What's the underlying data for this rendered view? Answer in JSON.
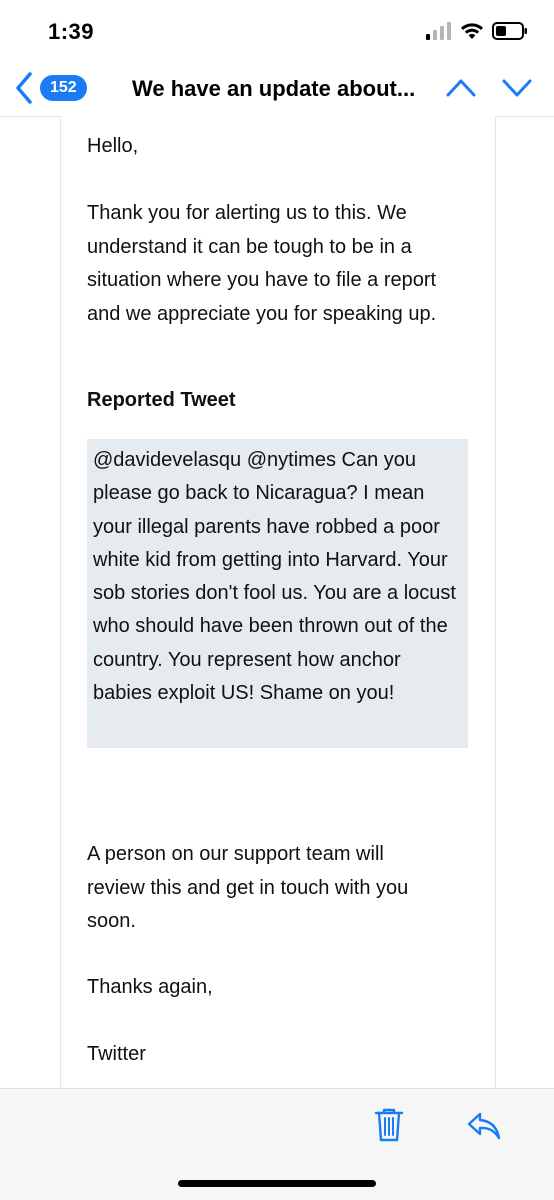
{
  "status_bar": {
    "time": "1:39"
  },
  "nav": {
    "back_count": "152",
    "title": "We have an update about..."
  },
  "message": {
    "greeting": "Hello,",
    "intro": "Thank you for alerting us to this. We understand it can be tough to be in a situation where you have to file a report and we appreciate you for speaking up.",
    "reported_heading": "Reported Tweet",
    "reported_tweet": "@davidevelasqu @nytimes Can you please go back to Nicaragua? I mean your illegal parents have robbed a poor white kid from getting into Harvard. Your sob stories don't fool us. You are a locust who should have been thrown out of the country. You represent how anchor babies exploit US! Shame on you!",
    "followup": "A person on our support team will review this and get in touch with you soon.",
    "closing": "Thanks again,",
    "signature": "Twitter"
  },
  "colors": {
    "accent": "#1a7cf5",
    "quote_bg": "#e6ebf0",
    "toolbar_bg": "#f6f6f7"
  },
  "toolbar": {
    "icons": [
      "trash-icon",
      "reply-icon"
    ]
  }
}
